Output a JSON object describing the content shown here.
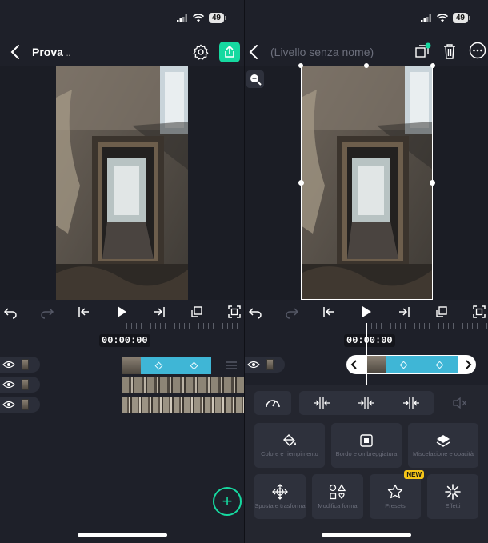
{
  "status": {
    "battery": "49"
  },
  "left": {
    "title": "Prova",
    "title_suffix": "..",
    "timecode": "00:00:00",
    "add_label": "+"
  },
  "right": {
    "title": "(Livello senza nome)",
    "timecode": "00:00:00",
    "tools_row2": [
      {
        "label": "Colore e riempimento",
        "icon": "paint-bucket-icon"
      },
      {
        "label": "Bordo e ombreggiatura",
        "icon": "border-shadow-icon"
      },
      {
        "label": "Miscelazione e opacità",
        "icon": "layers-blend-icon"
      }
    ],
    "tools_row3": [
      {
        "label": "Sposta e trasforma",
        "icon": "move-transform-icon"
      },
      {
        "label": "Modifica forma",
        "icon": "shapes-icon"
      },
      {
        "label": "Presets",
        "icon": "star-icon",
        "badge": "NEW"
      },
      {
        "label": "Effetti",
        "icon": "sparkle-icon"
      }
    ]
  },
  "colors": {
    "accent": "#16d9a0",
    "clip": "#3fb6d6",
    "bg": "#1e2029"
  }
}
